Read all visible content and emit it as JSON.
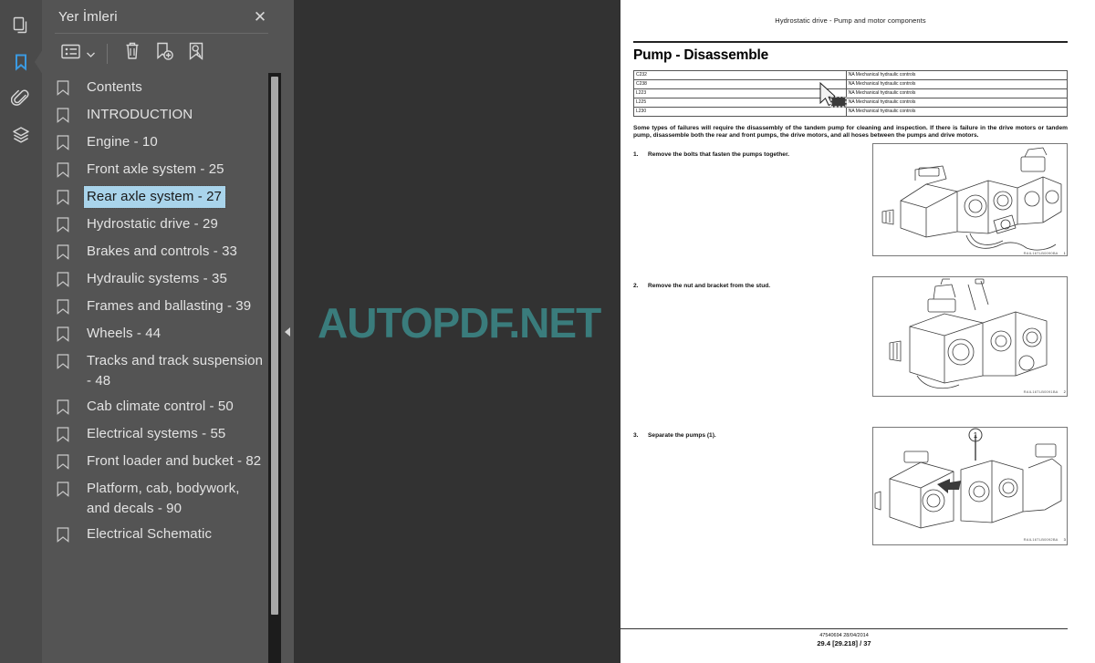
{
  "rail": {
    "items": [
      {
        "icon": "pages-thumbnails-icon",
        "name": "rail-item-thumbnails",
        "active": false
      },
      {
        "icon": "bookmark-icon",
        "name": "rail-item-bookmarks",
        "active": true
      },
      {
        "icon": "paperclip-attachments-icon",
        "name": "rail-item-attachments",
        "active": false
      },
      {
        "icon": "layers-icon",
        "name": "rail-item-layers",
        "active": false
      }
    ],
    "active_color": "#3b9ae1"
  },
  "panel": {
    "title": "Yer İmleri",
    "close_label": "✕",
    "toolbar": {
      "options_icon": "list-options-icon",
      "options_caret_icon": "chevron-down-icon",
      "delete_icon": "trash-delete-icon",
      "new_bookmark_icon": "add-bookmark-icon",
      "select_bookmark_icon": "bookmark-pointer-icon"
    },
    "selection_color": "#a9d4eb",
    "bookmarks": [
      {
        "label": "Contents",
        "selected": false
      },
      {
        "label": "INTRODUCTION",
        "selected": false
      },
      {
        "label": "Engine - 10",
        "selected": false
      },
      {
        "label": "Front axle system - 25",
        "selected": false
      },
      {
        "label": "Rear axle system - 27",
        "selected": true
      },
      {
        "label": "Hydrostatic drive - 29",
        "selected": false
      },
      {
        "label": "Brakes and controls - 33",
        "selected": false
      },
      {
        "label": "Hydraulic systems - 35",
        "selected": false
      },
      {
        "label": "Frames and ballasting - 39",
        "selected": false
      },
      {
        "label": "Wheels - 44",
        "selected": false
      },
      {
        "label": "Tracks and track suspension - 48",
        "selected": false
      },
      {
        "label": "Cab climate control - 50",
        "selected": false
      },
      {
        "label": "Electrical systems - 55",
        "selected": false
      },
      {
        "label": "Front loader and bucket - 82",
        "selected": false
      },
      {
        "label": "Platform, cab, bodywork, and decals - 90",
        "selected": false
      },
      {
        "label": "Electrical Schematic",
        "selected": false
      }
    ]
  },
  "viewer": {
    "collapse_icon": "collapse-left-arrow-icon",
    "watermark": "AUTOPDF.NET",
    "watermark_color": "#3a7c7c",
    "cursor_icon": "pointer-drag-cursor"
  },
  "document": {
    "running_header": "Hydrostatic drive - Pump and motor components",
    "title": "Pump - Disassemble",
    "spec_table": {
      "rows": [
        [
          "C232",
          "NA Mechanical hydraulic controls"
        ],
        [
          "C238",
          "NA Mechanical hydraulic controls"
        ],
        [
          "L223",
          "NA Mechanical hydraulic controls"
        ],
        [
          "L225",
          "NA Mechanical hydraulic controls"
        ],
        [
          "L230",
          "NA Mechanical hydraulic controls"
        ]
      ]
    },
    "intro": "Some types of failures will require the disassembly of the tandem pump for cleaning and inspection. If there is failure in the drive motors or tandem pump, disassemble both the rear and front pumps, the drive motors, and all hoses between the pumps and drive motors.",
    "steps": [
      {
        "num": "1.",
        "text": "Remove the bolts that fasten the pumps together.",
        "figure_caption": "RAIL16TLB0090BA",
        "figure_number": "1"
      },
      {
        "num": "2.",
        "text": "Remove the nut and bracket from the stud.",
        "figure_caption": "RAIL16TLB0091BA",
        "figure_number": "2"
      },
      {
        "num": "3.",
        "text": "Separate the pumps (1).",
        "figure_caption": "RAIL16TLB0092BA",
        "figure_number": "3"
      }
    ],
    "footer": {
      "doc_number": "47540694 28/04/2014",
      "page_ref": "29.4 [29.218] / 37"
    }
  }
}
